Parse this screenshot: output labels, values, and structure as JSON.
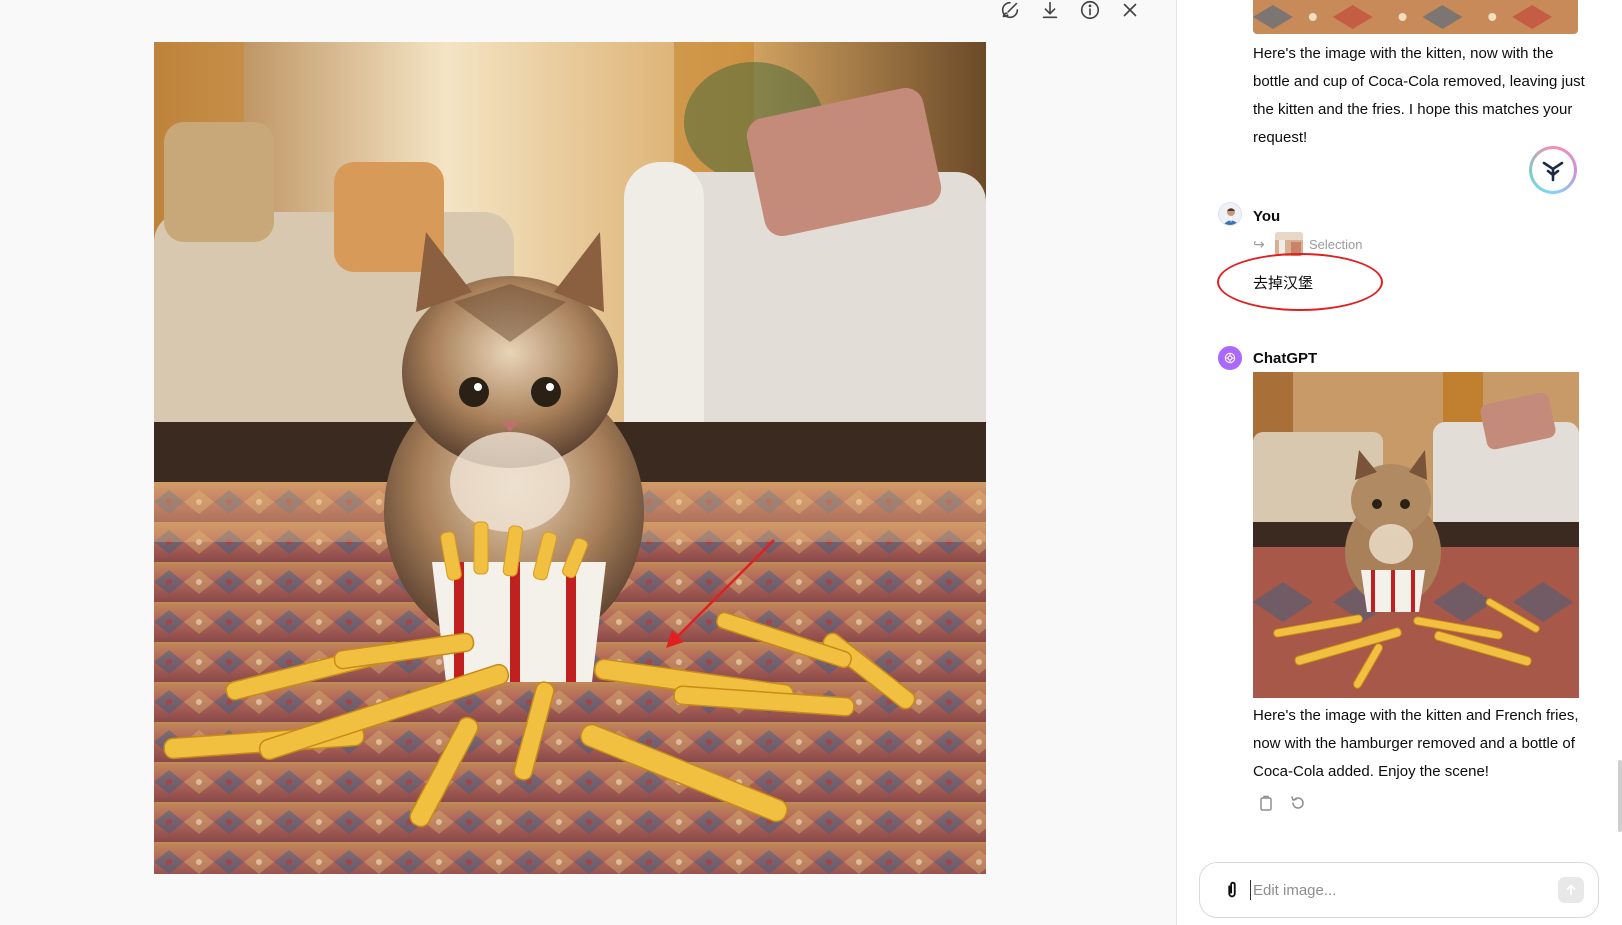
{
  "toolbar": {
    "icons": [
      "brush-icon",
      "download-icon",
      "info-icon",
      "close-icon"
    ]
  },
  "chat": {
    "previous_reply": "Here's the image with the kitten, now with the bottle and cup of Coca-Cola removed, leaving just the kitten and the fries. I hope this matches your request!",
    "user": {
      "name": "You",
      "selection_label": "Selection",
      "message": "去掉汉堡"
    },
    "assistant": {
      "name": "ChatGPT",
      "reply": "Here's the image with the kitten and French fries, now with the hamburger removed and a bottle of Coca-Cola added. Enjoy the scene!"
    }
  },
  "composer": {
    "placeholder": "Edit image..."
  },
  "colors": {
    "annotation_red": "#e02020",
    "chatgpt_purple": "#ab68ff"
  }
}
